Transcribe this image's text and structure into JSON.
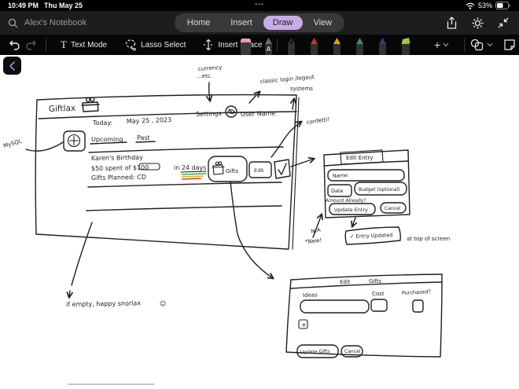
{
  "status_bar": {
    "time": "10:49 PM",
    "date": "Thu May 25",
    "multitask_handle": "•••",
    "battery_percent": "53%"
  },
  "nav_bar": {
    "notebook_title": "Alex's Notebook",
    "tabs": [
      {
        "label": "Home"
      },
      {
        "label": "Insert"
      },
      {
        "label": "Draw"
      },
      {
        "label": "View"
      }
    ],
    "active_tab": "Draw"
  },
  "draw_toolbar": {
    "text_mode_glyph": "T",
    "text_mode_label": "Text Mode",
    "lasso_label": "Lasso Select",
    "insert_space_label": "Insert Space",
    "add_pen_glyph": "+",
    "pen_a_label": "A"
  },
  "pens": [
    {
      "name": "pen-a",
      "tip": "#6e6e70"
    },
    {
      "name": "pen-black",
      "tip": "#3c3c3e"
    },
    {
      "name": "pen-red",
      "tip": "#c0392b"
    },
    {
      "name": "pen-yellow",
      "tip": "#d9a514"
    },
    {
      "name": "pen-green",
      "tip": "#27995c"
    },
    {
      "name": "pen-blue",
      "tip": "#2c3e8c"
    },
    {
      "name": "highlighter-green",
      "tip": "#9ccd3e"
    }
  ],
  "colors": {
    "accent_purple": "#c9ade9",
    "ink": "#1f1f1f",
    "sketch_green": "#35c45e",
    "underline_green": "#3fae4c",
    "underline_yellow": "#d9b726",
    "underline_red": "#e04438",
    "eraser_pink": "#ef9aa8"
  },
  "sketch": {
    "app_window": {
      "title": "Giftlax",
      "settings": "Settings",
      "user": "User Name",
      "today_label": "Today:",
      "today_date": "May 25 , 2023",
      "tab_upcoming": "Upcoming",
      "tab_past": "Past",
      "entry_title": "Karen's Birthday",
      "entry_budget": "$50 spent of $100",
      "entry_countdown": "in 24 days",
      "entry_gifts": "Gifts Planned: CD",
      "gifts_button": "Gifts",
      "edit_button": "Edit"
    },
    "annotations": {
      "currency_line1": "currency",
      "currency_line2": "...etc.",
      "login_line1": "classic login /logout",
      "login_line2": "systems",
      "confetti": "confetti!",
      "database": "MySQL",
      "na": "N/A",
      "new": "*New!",
      "empty_state": "if  empty,  happy  snorlax",
      "smiley": "☺",
      "toast_position": "at top of screen"
    },
    "edit_entry_panel": {
      "title": "Edit Entry",
      "field_name": "Name",
      "field_date": "Date",
      "field_budget": "Budget  (optional)",
      "note": "Amount Already?",
      "update_button": "Update Entry",
      "cancel_button": "Cancel",
      "toast": "✓ Entry Updated"
    },
    "gifts_form": {
      "tab_edit": "Edit",
      "tab_gifts": "Gifts",
      "col_ideas": "Ideas",
      "col_cost": "Cost",
      "col_purchased": "Purchased?",
      "add_button": "+",
      "update_button": "Update Gifts",
      "cancel_button": "Cancel"
    }
  }
}
